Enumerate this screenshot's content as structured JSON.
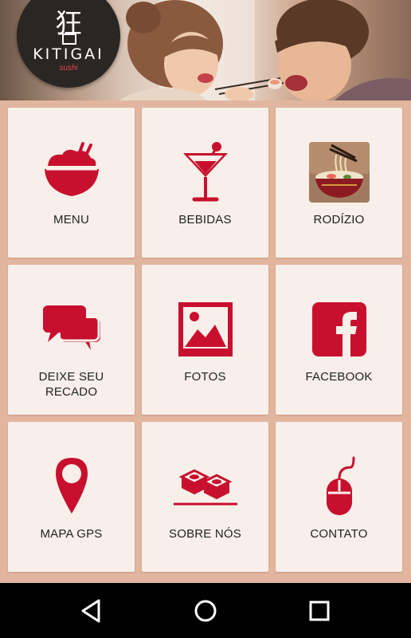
{
  "header": {
    "logo_kanji": "狂",
    "logo_name": "KITIGAI",
    "logo_sub": "sushi"
  },
  "tiles": [
    {
      "label": "MENU",
      "icon": "rice-bowl-icon"
    },
    {
      "label": "BEBIDAS",
      "icon": "cocktail-icon"
    },
    {
      "label": "RODÍZIO",
      "icon": "ramen-bowl-icon"
    },
    {
      "label": "DEIXE SEU RECADO",
      "icon": "chat-bubbles-icon"
    },
    {
      "label": "FOTOS",
      "icon": "photo-icon"
    },
    {
      "label": "FACEBOOK",
      "icon": "facebook-icon"
    },
    {
      "label": "MAPA GPS",
      "icon": "map-pin-icon"
    },
    {
      "label": "SOBRE NÓS",
      "icon": "sushi-icon"
    },
    {
      "label": "CONTATO",
      "icon": "mouse-icon"
    }
  ],
  "colors": {
    "accent": "#c8102e",
    "tile_bg": "#f8efea",
    "page_bg": "#e2b69e"
  },
  "navbar": {
    "back": "back-icon",
    "home": "home-icon",
    "recents": "recents-icon"
  }
}
